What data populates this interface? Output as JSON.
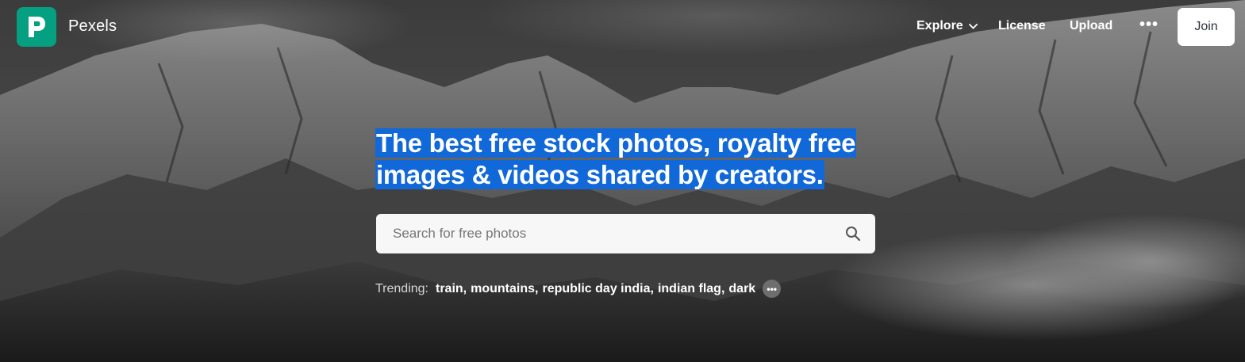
{
  "brand": {
    "name": "Pexels",
    "logo_icon": "pexels-logo-icon",
    "logo_color": "#05a081"
  },
  "nav": {
    "explore": "Explore",
    "license": "License",
    "upload": "Upload",
    "more": "•••",
    "join": "Join"
  },
  "hero": {
    "headline": "The best free stock photos, royalty free images & videos shared by creators.",
    "highlight_color": "#1168d9"
  },
  "search": {
    "placeholder": "Search for free photos",
    "icon": "search-icon"
  },
  "trending": {
    "label": "Trending:",
    "tags": [
      "train",
      "mountains",
      "republic day india",
      "indian flag",
      "dark"
    ],
    "more_icon": "more-dots-icon"
  }
}
